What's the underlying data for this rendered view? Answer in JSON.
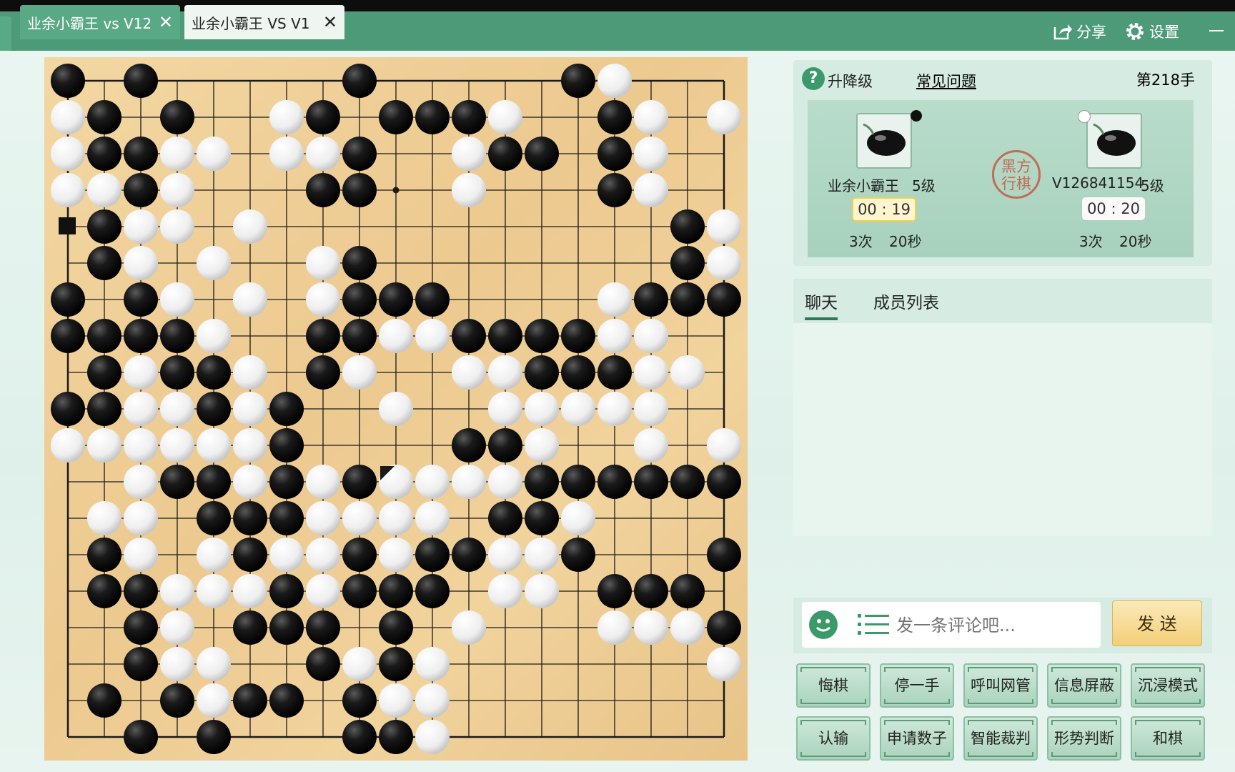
{
  "tabs": [
    {
      "label": "业余小霸王 vs V12",
      "close": "✕",
      "active": false
    },
    {
      "label": "业余小霸王 VS V1",
      "close": "✕",
      "active": true
    }
  ],
  "header": {
    "share_label": "分享",
    "settings_label": "设置"
  },
  "info": {
    "level_label": "升降级",
    "faq_label": "常见问题",
    "move_count": "第218手",
    "turn_seal": "黑方行棋",
    "black_player": {
      "name": "业余小霸王",
      "rank": "5级",
      "clock": "00 : 19",
      "periods": "3次",
      "period_time": "20秒"
    },
    "white_player": {
      "name": "V126841154",
      "rank": "5级",
      "clock": "00 : 20",
      "periods": "3次",
      "period_time": "20秒"
    }
  },
  "chat": {
    "tab_chat": "聊天",
    "tab_members": "成员列表",
    "placeholder": "发一条评论吧...",
    "send_label": "发 送"
  },
  "actions": {
    "row1": [
      "悔棋",
      "停一手",
      "呼叫网管",
      "信息屏蔽",
      "沉浸模式"
    ],
    "row2": [
      "认输",
      "申请数子",
      "智能裁判",
      "形势判断",
      "和棋"
    ]
  },
  "board": {
    "size": 19,
    "last_move": "K8",
    "rows": [
      "B.B.....B.....BW...",
      "WB.B..WB.BBBW..BW.W",
      "WBBWW.WWB..WBB.BW..",
      "WWBW...BB..W...BW..",
      ".BWW.W...........BW",
      ".BW.W..WB........BW",
      "B.BW.W.WBBB....WBBB",
      "BBBBW..BBWWBBBBWW..",
      ".BWBBW.BW..WWBBBWW.",
      "BBWWBWB..W..WWWWW..",
      "WWWWWWB....BBW..W.W",
      "..WBBWBWBWWWWBBBBBB",
      ".WW.BBBWWWW.BBW....",
      ".BW.WBWWBWBBWWB...B",
      ".BBWWWBWBBB.WW.BBB.",
      "..BW.BBB.B.W...WWWBB",
      "..BWW..BWBW.......WW",
      ".B.BWBB.BWW........",
      "..B.B...BBW........"
    ]
  }
}
